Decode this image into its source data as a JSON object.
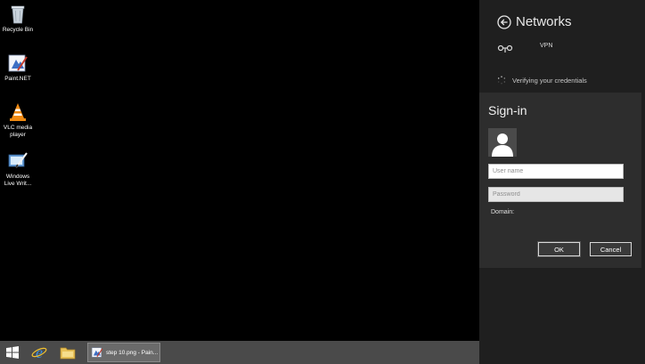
{
  "desktop": {
    "icons": [
      {
        "label": "Recycle Bin",
        "icon": "recycle-bin-icon"
      },
      {
        "label": "Paint.NET",
        "icon": "paint-net-icon"
      },
      {
        "label": "VLC media player",
        "icon": "vlc-icon"
      },
      {
        "label": "Windows Live Writ...",
        "icon": "windows-live-writer-icon"
      }
    ]
  },
  "taskbar": {
    "task_label": "step 10.png - Pain..."
  },
  "networks": {
    "title": "Networks",
    "vpn_label": "VPN",
    "status": "Verifying your credentials"
  },
  "signin": {
    "title": "Sign-in",
    "username_placeholder": "User name",
    "password_placeholder": "Password",
    "domain_label": "Domain:",
    "ok_label": "OK",
    "cancel_label": "Cancel"
  },
  "colors": {
    "desktop": "#000000",
    "taskbar": "#4a4a4a",
    "panel": "#1f1f1f",
    "flyout": "#2d2d2d"
  }
}
